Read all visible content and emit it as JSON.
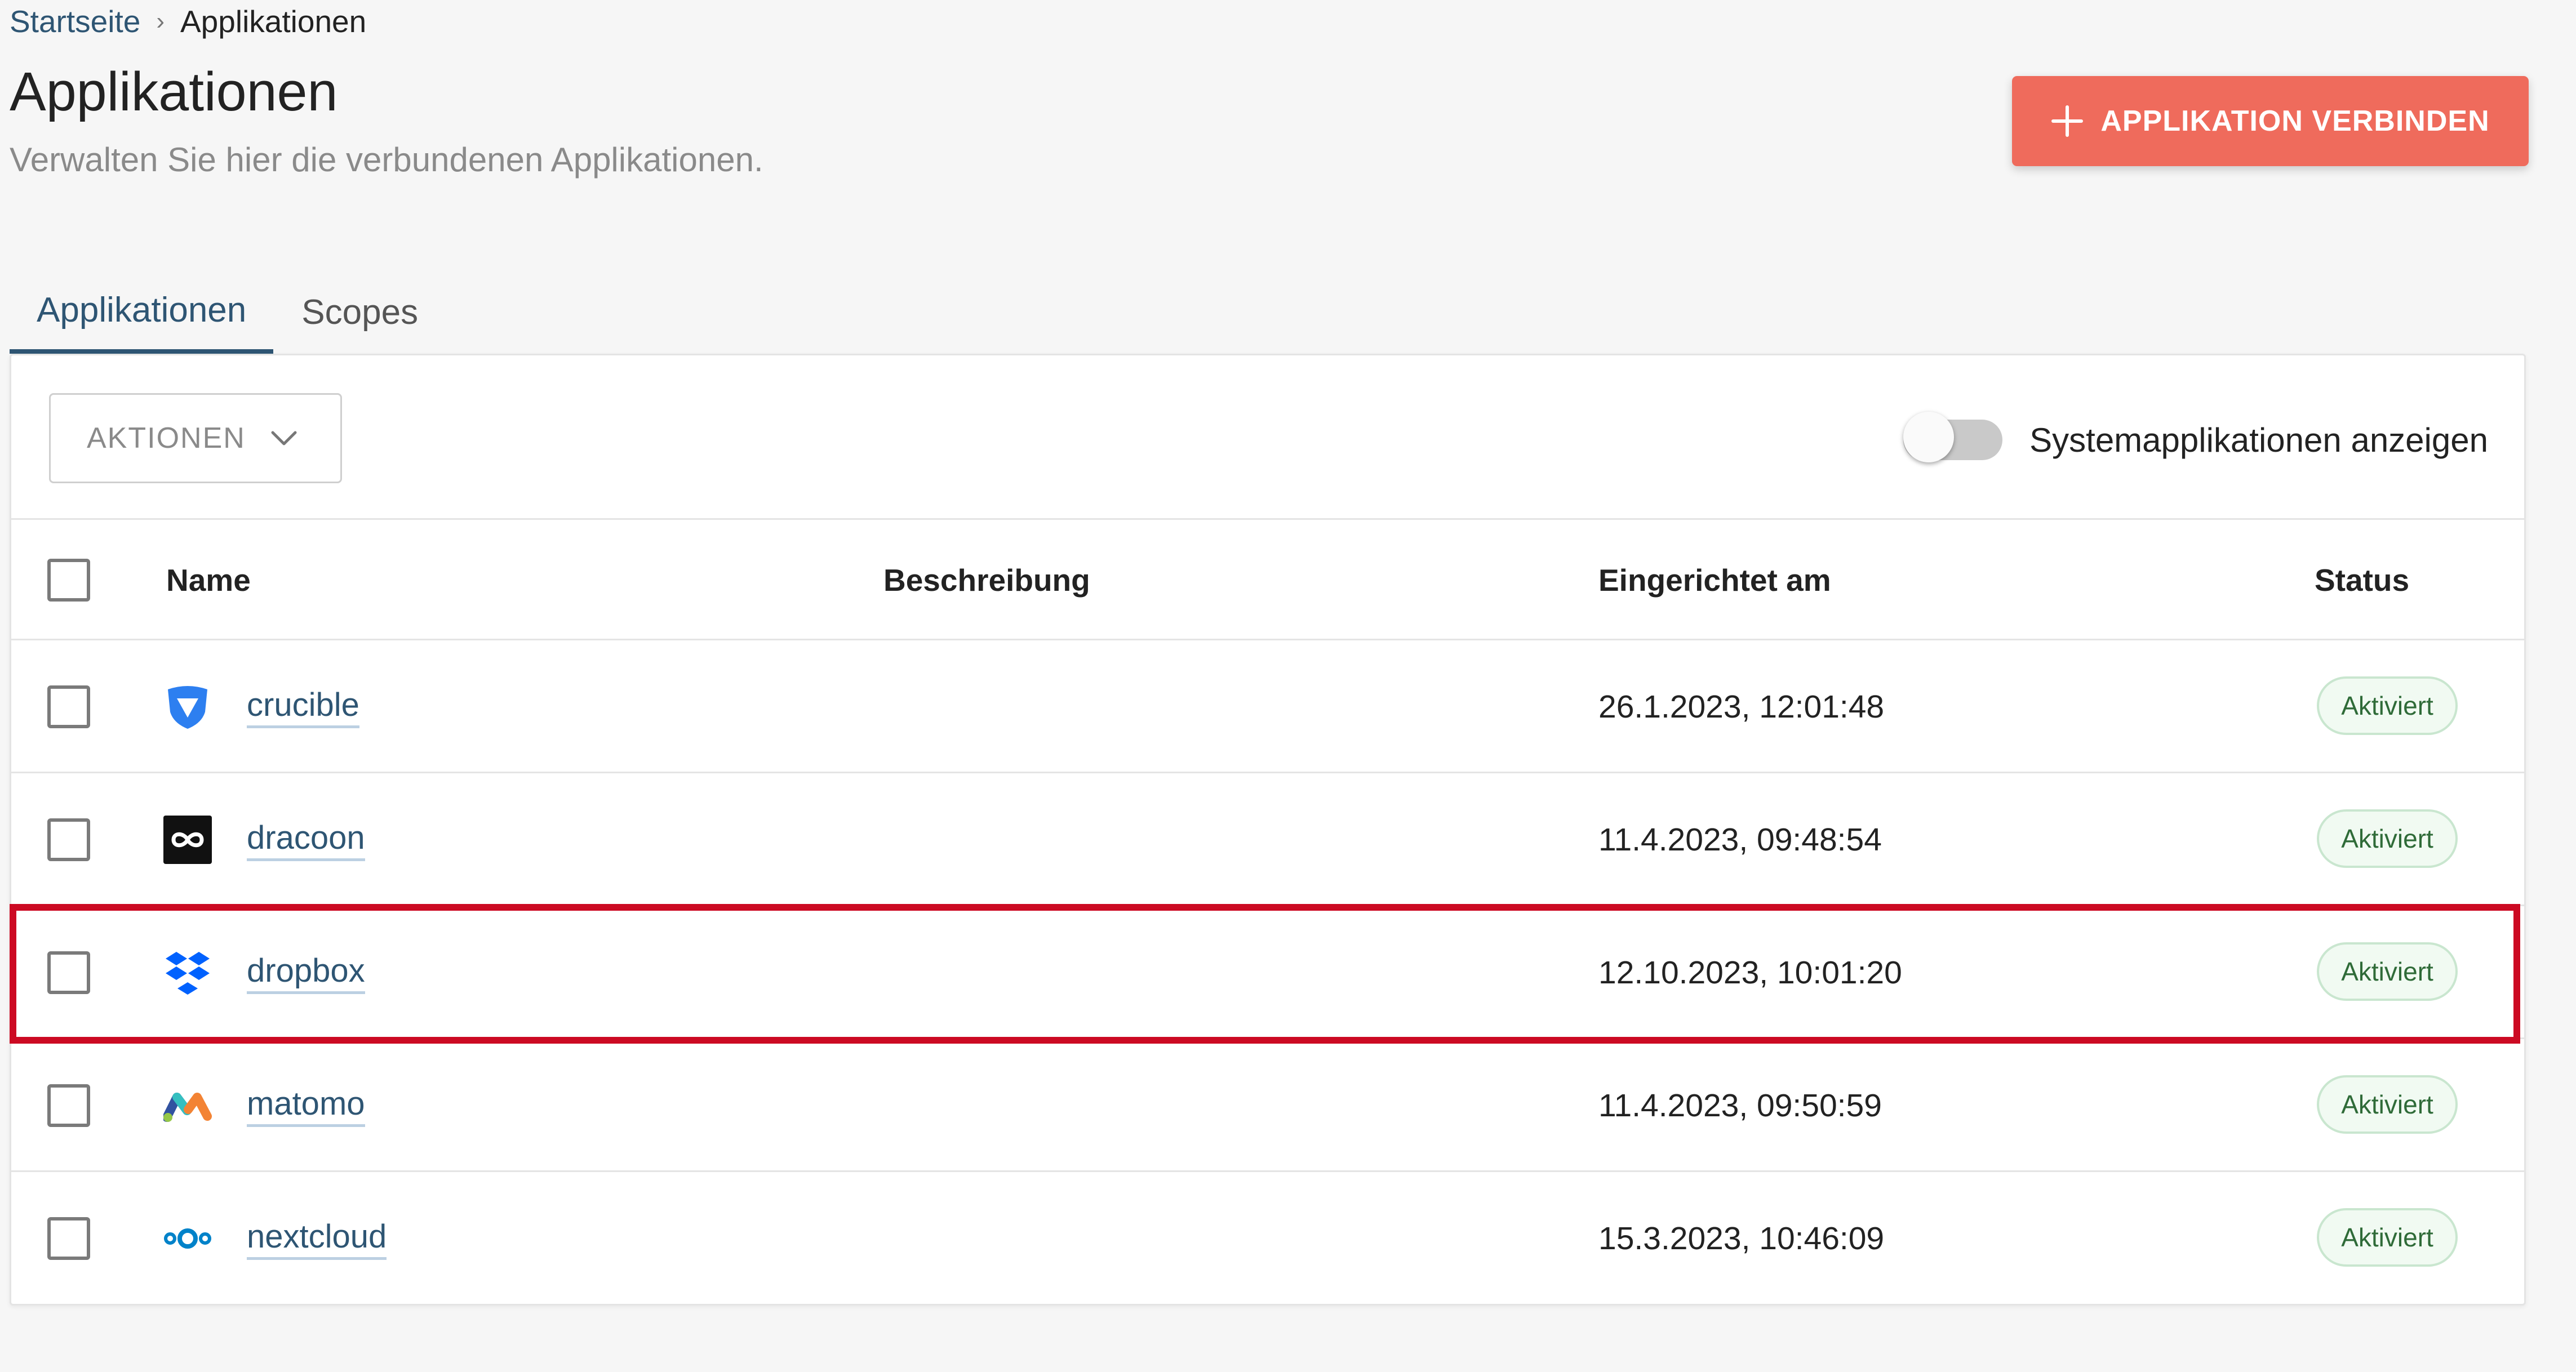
{
  "breadcrumb": {
    "home": "Startseite",
    "separator": "›",
    "current": "Applikationen"
  },
  "page": {
    "title": "Applikationen",
    "subtitle": "Verwalten Sie hier die verbundenen Applikationen."
  },
  "connect_button": {
    "icon": "plus-icon",
    "label": "APPLIKATION VERBINDEN",
    "color": "#ef6b5c"
  },
  "tabs": [
    {
      "label": "Applikationen",
      "active": true
    },
    {
      "label": "Scopes",
      "active": false
    }
  ],
  "toolbar": {
    "actions_label": "AKTIONEN",
    "toggle_label": "Systemapplikationen anzeigen",
    "toggle_on": false
  },
  "table": {
    "columns": {
      "name": "Name",
      "description": "Beschreibung",
      "created": "Eingerichtet am",
      "status": "Status"
    },
    "rows": [
      {
        "name": "crucible",
        "icon": "crucible-icon",
        "description": "",
        "created": "26.1.2023, 12:01:48",
        "status": "Aktiviert"
      },
      {
        "name": "dracoon",
        "icon": "dracoon-icon",
        "description": "",
        "created": "11.4.2023, 09:48:54",
        "status": "Aktiviert"
      },
      {
        "name": "dropbox",
        "icon": "dropbox-icon",
        "description": "",
        "created": "12.10.2023, 10:01:20",
        "status": "Aktiviert",
        "highlighted": true
      },
      {
        "name": "matomo",
        "icon": "matomo-icon",
        "description": "",
        "created": "11.4.2023, 09:50:59",
        "status": "Aktiviert"
      },
      {
        "name": "nextcloud",
        "icon": "nextcloud-icon",
        "description": "",
        "created": "15.3.2023, 10:46:09",
        "status": "Aktiviert"
      }
    ]
  },
  "colors": {
    "accent": "#2e5573",
    "primary_button": "#ef6b5c",
    "highlight": "#cc0a23",
    "status_text": "#2f6b38",
    "status_bg": "#f1faf2"
  }
}
